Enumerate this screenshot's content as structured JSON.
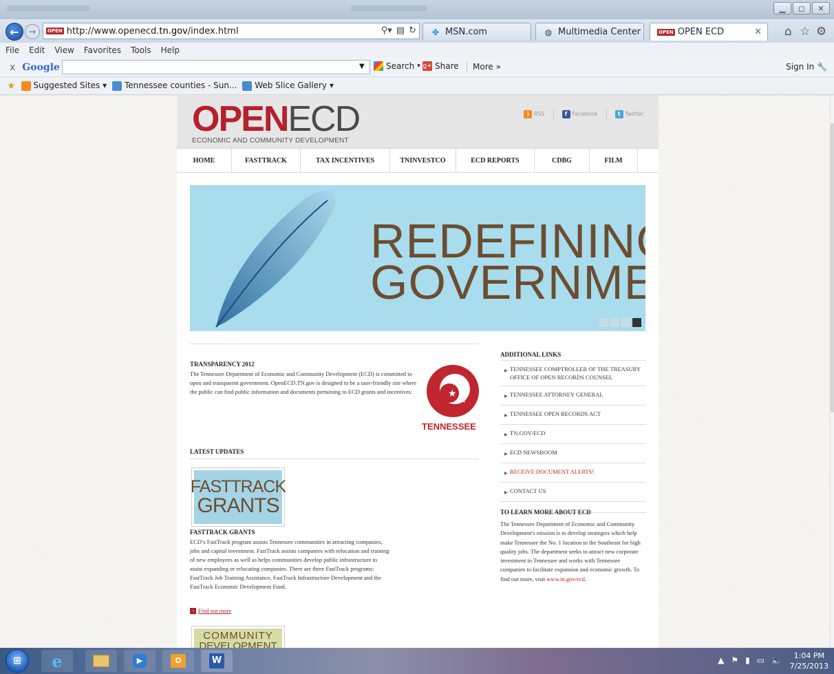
{
  "browser": {
    "url_prefix": "http://www.openecd.",
    "url_domain": "tn.gov",
    "url_suffix": "/index.html",
    "favicon_badge": "OPEN",
    "tabs": [
      {
        "label": "MSN.com",
        "icon": "msn-icon"
      },
      {
        "label": "Multimedia Center",
        "icon": "globe-icon"
      },
      {
        "label": "OPEN ECD",
        "icon": "openecd-favicon",
        "active": true
      }
    ],
    "menu": [
      "File",
      "Edit",
      "View",
      "Favorites",
      "Tools",
      "Help"
    ],
    "google_bar": {
      "close": "x",
      "logo": "Google",
      "search_label": "Search",
      "share_label": "Share",
      "more_label": "More »",
      "signin_label": "Sign In"
    },
    "favorites": [
      {
        "label": "Suggested Sites ▾",
        "icon": "suggested-sites-icon"
      },
      {
        "label": "Tennessee counties - Sun...",
        "icon": "ie-page-icon"
      },
      {
        "label": "Web Slice Gallery ▾",
        "icon": "ie-page-icon"
      }
    ]
  },
  "site": {
    "logo_open": "OPEN",
    "logo_ecd": "ECD",
    "logo_subtitle": "ECONOMIC AND COMMUNITY DEVELOPMENT",
    "social": [
      {
        "label": "RSS",
        "color": "#f58b23"
      },
      {
        "label": "Facebook",
        "color": "#3b5998"
      },
      {
        "label": "Twitter",
        "color": "#4aa6d8"
      }
    ],
    "nav": [
      "HOME",
      "FASTTRACK",
      "TAX INCENTIVES",
      "TNINVESTCO",
      "ECD REPORTS",
      "CDBG",
      "FILM"
    ],
    "banner": {
      "line1": "REDEFINING",
      "line2": "GOVERNMENT",
      "slides": 4,
      "active_slide": 4
    },
    "transparency": {
      "title": "TRANSPARENCY 2012",
      "body": "The Tennessee Department of Economic and Community Development (ECD) is committed to open and transparent government. OpenECD.TN.gov is designed to be a user-friendly site where the public can find public information and documents pertaining to ECD grants and incentives.",
      "seal_label": "TENNESSEE"
    },
    "latest_updates": {
      "title": "LATEST UPDATES",
      "items": [
        {
          "thumb_line1": "FASTTRACK",
          "thumb_line2": "GRANTS",
          "title": "FASTTRACK GRANTS",
          "body": "ECD’s FastTrack program assists Tennessee communities in attracting companies, jobs and capital investment. FastTrack assists companies with relocation and training of new employees as well as helps communities develop public infrastructure to assist expanding or relocating companies. There are three FastTrack programs: FastTrack Job Training Assistance, FastTrack Infrastructure Development and the FastTrack Economic Development Fund.",
          "more_label": "Find out more"
        },
        {
          "thumb_line1": "COMMUNITY",
          "thumb_line2": "DEVELOPMENT"
        }
      ]
    },
    "additional_links": {
      "title": "ADDITIONAL LINKS",
      "items": [
        {
          "label": "TENNESSEE COMPTROLLER OF THE TREASURY OFFICE OF OPEN RECORDS COUNSEL"
        },
        {
          "label": "TENNESSEE ATTORNEY GENERAL"
        },
        {
          "label": "TENNESSEE OPEN RECORDS ACT"
        },
        {
          "label": "TN.GOV/ECD"
        },
        {
          "label": "ECD NEWSROOM"
        },
        {
          "label": "RECEIVE DOCUMENT ALERTS!",
          "highlight": true
        },
        {
          "label": "CONTACT US"
        }
      ]
    },
    "learn_more": {
      "title": "TO LEARN MORE ABOUT ECD",
      "body": "The Tennessee Department of Economic and Community Development's mission is to develop strategies which help make Tennessee the No. 1 location in the Southeast for high quality jobs. The department seeks to attract new corporate investment in Tennessee and works with Tennessee companies to facilitate expansion and economic growth. To find out more, visit",
      "link": "www.tn.gov/ecd."
    },
    "colors": {
      "brand_red": "#b3212c",
      "banner_blue": "#a9dcec",
      "banner_text": "#6b4e32"
    }
  },
  "taskbar": {
    "apps": [
      "windows-start",
      "internet-explorer",
      "file-explorer",
      "media-player",
      "outlook",
      "word"
    ],
    "time": "1:04 PM",
    "date": "7/25/2013"
  }
}
